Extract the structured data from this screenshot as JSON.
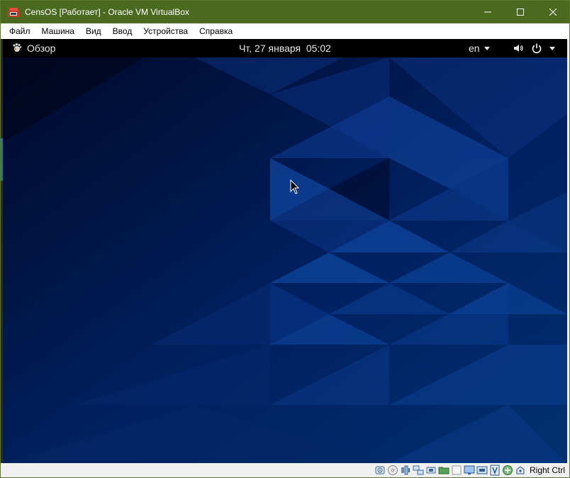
{
  "window": {
    "title": "CensOS [Работает] - Oracle VM VirtualBox",
    "frame_color": "#4a6a20"
  },
  "menu": {
    "items": [
      "Файл",
      "Машина",
      "Вид",
      "Ввод",
      "Устройства",
      "Справка"
    ]
  },
  "gnome": {
    "activities_label": "Обзор",
    "clock": "Чт, 27 января  05:02",
    "language": "en",
    "tray_icons": [
      "volume-icon",
      "power-icon"
    ]
  },
  "statusbar": {
    "icons": [
      "hard-disk-icon",
      "optical-drive-icon",
      "audio-icon",
      "network-icon",
      "usb-icon",
      "shared-folders-icon",
      "display-icon",
      "video-capture-icon",
      "cpu-virtualization-icon",
      "mouse-integration-icon",
      "keyboard-icon"
    ],
    "host_key": "Right Ctrl"
  },
  "colors": {
    "desktop_base": "#001a4d",
    "desktop_accent": "#0a3a8a",
    "gnome_bar": "#000000"
  }
}
